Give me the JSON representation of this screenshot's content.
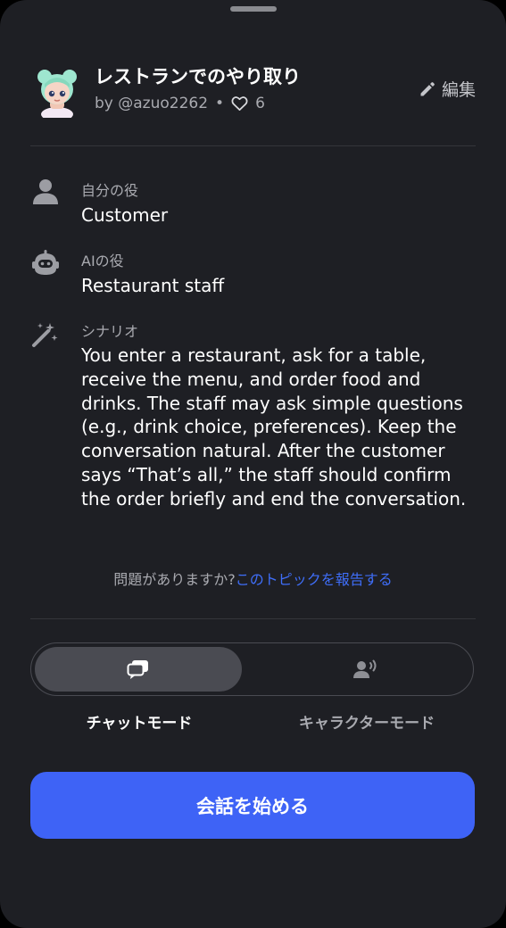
{
  "topic": {
    "title": "レストランでのやり取り",
    "author": "by @azuo2262",
    "separator": "•",
    "likes": "6",
    "edit_label": "編集"
  },
  "roles": {
    "user_role_label": "自分の役",
    "user_role_value": "Customer",
    "ai_role_label": "AIの役",
    "ai_role_value": "Restaurant staff",
    "scenario_label": "シナリオ",
    "scenario_text": "You enter a restaurant, ask for a table, receive the menu, and order food and drinks. The staff may ask simple questions (e.g., drink choice, preferences). Keep the conversation natural. After the customer says “That’s all,” the staff should confirm the order briefly and end the conversation."
  },
  "report": {
    "question": "問題がありますか?",
    "link": "このトピックを報告する"
  },
  "modes": {
    "selected": "chat",
    "chat_label": "チャットモード",
    "character_label": "キャラクターモード"
  },
  "start_button_label": "会話を始める",
  "icons": {
    "avatar": "character-avatar",
    "heart": "heart-outline-icon",
    "edit": "pencil-icon",
    "user": "person-icon",
    "ai": "robot-icon",
    "scenario": "magic-wand-icon",
    "chat": "chat-bubbles-icon",
    "character": "voice-person-icon"
  },
  "colors": {
    "background": "#1e1f24",
    "accent": "#3e63f6",
    "link": "#3f6ef8",
    "muted_text": "#a9aab0"
  }
}
